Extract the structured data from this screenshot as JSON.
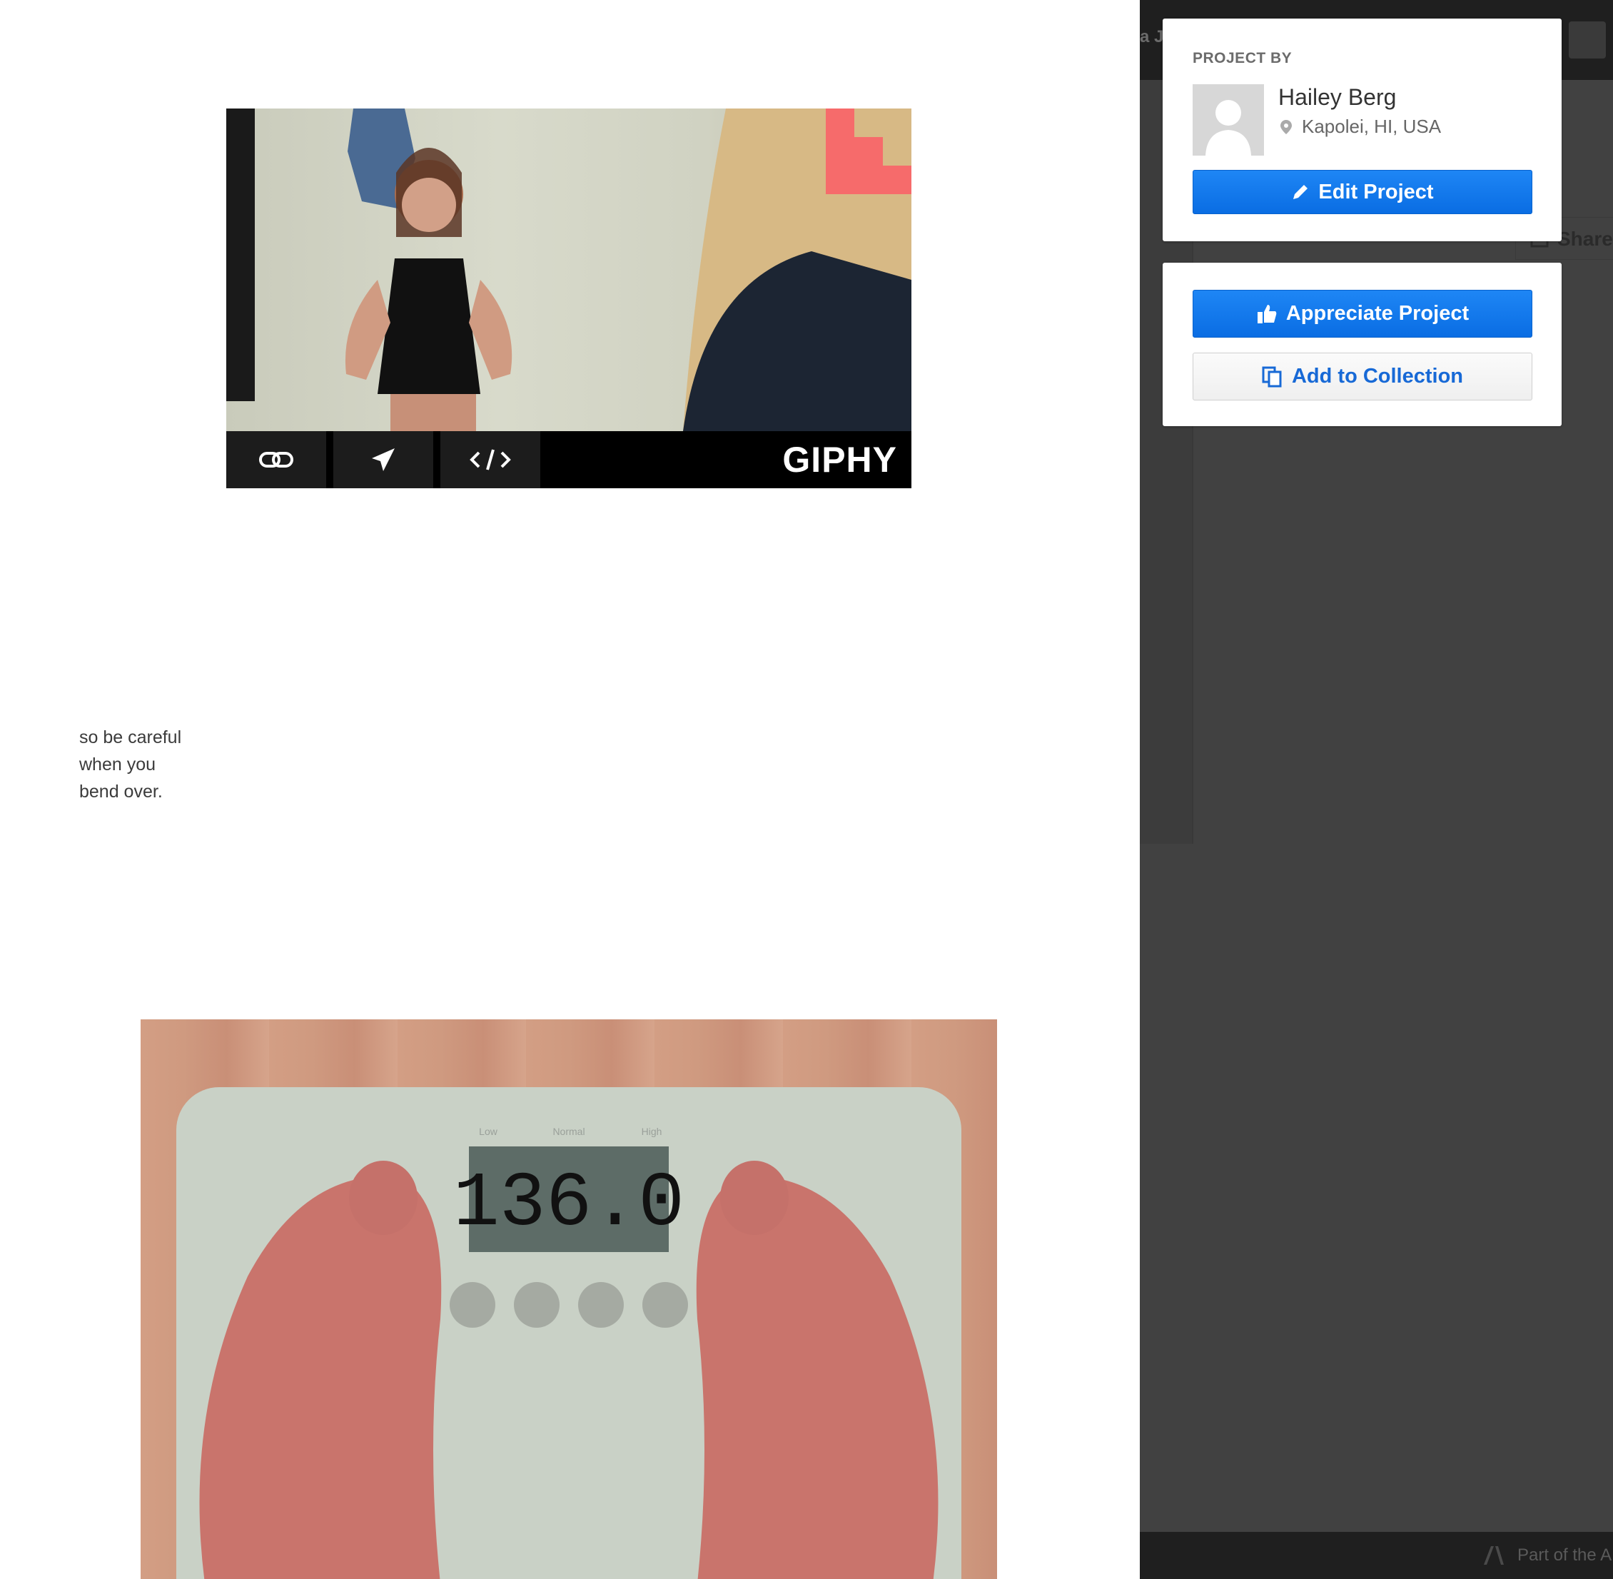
{
  "gif": {
    "toolbar": {
      "link_icon": "link-icon",
      "send_icon": "paper-plane-icon",
      "embed_icon": "code-embed-icon"
    },
    "logo_text": "GIPHY",
    "accent_color": "#f66b6b"
  },
  "caption": {
    "line1": "so be careful",
    "line2": "when you",
    "line3": "bend over."
  },
  "scale_photo": {
    "display_value": "136.0",
    "indicator_labels": [
      "Low",
      "Normal",
      "High"
    ]
  },
  "overlay": {
    "topbar_name_fragment": "a Jo",
    "share_fragment": "Share",
    "footer_text": "Part of the A"
  },
  "owner_card": {
    "label": "PROJECT BY",
    "name": "Hailey Berg",
    "location": "Kapolei, HI, USA",
    "edit_button": "Edit Project"
  },
  "actions_card": {
    "appreciate_button": "Appreciate Project",
    "collection_button": "Add to Collection"
  },
  "colors": {
    "primary_blue": "#0a6de3",
    "overlay_dark": "#414141",
    "link_blue": "#1769d6"
  }
}
